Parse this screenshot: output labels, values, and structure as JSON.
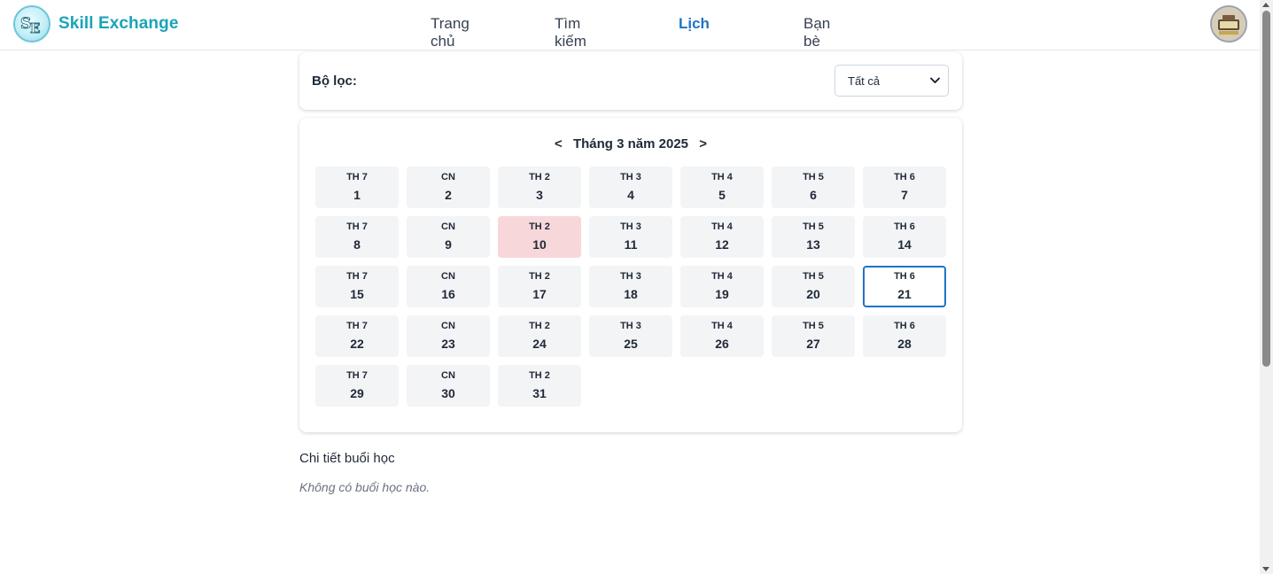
{
  "brand": {
    "name": "Skill Exchange",
    "logo_text": "SE"
  },
  "nav": [
    {
      "label": "Trang chủ",
      "active": false
    },
    {
      "label": "Tìm kiếm",
      "active": false
    },
    {
      "label": "Lịch",
      "active": true
    },
    {
      "label": "Bạn bè",
      "active": false
    }
  ],
  "filter": {
    "label": "Bộ lọc:",
    "selected": "Tất cả"
  },
  "calendar": {
    "prev": "<",
    "next": ">",
    "month_label": "Tháng 3 năm 2025",
    "days": [
      {
        "dow": "TH 7",
        "num": "1"
      },
      {
        "dow": "CN",
        "num": "2"
      },
      {
        "dow": "TH 2",
        "num": "3"
      },
      {
        "dow": "TH 3",
        "num": "4"
      },
      {
        "dow": "TH 4",
        "num": "5"
      },
      {
        "dow": "TH 5",
        "num": "6"
      },
      {
        "dow": "TH 6",
        "num": "7"
      },
      {
        "dow": "TH 7",
        "num": "8"
      },
      {
        "dow": "CN",
        "num": "9"
      },
      {
        "dow": "TH 2",
        "num": "10",
        "state": "today"
      },
      {
        "dow": "TH 3",
        "num": "11"
      },
      {
        "dow": "TH 4",
        "num": "12"
      },
      {
        "dow": "TH 5",
        "num": "13"
      },
      {
        "dow": "TH 6",
        "num": "14"
      },
      {
        "dow": "TH 7",
        "num": "15"
      },
      {
        "dow": "CN",
        "num": "16"
      },
      {
        "dow": "TH 2",
        "num": "17"
      },
      {
        "dow": "TH 3",
        "num": "18"
      },
      {
        "dow": "TH 4",
        "num": "19"
      },
      {
        "dow": "TH 5",
        "num": "20"
      },
      {
        "dow": "TH 6",
        "num": "21",
        "state": "selected"
      },
      {
        "dow": "TH 7",
        "num": "22"
      },
      {
        "dow": "CN",
        "num": "23"
      },
      {
        "dow": "TH 2",
        "num": "24"
      },
      {
        "dow": "TH 3",
        "num": "25"
      },
      {
        "dow": "TH 4",
        "num": "26"
      },
      {
        "dow": "TH 5",
        "num": "27"
      },
      {
        "dow": "TH 6",
        "num": "28"
      },
      {
        "dow": "TH 7",
        "num": "29"
      },
      {
        "dow": "CN",
        "num": "30"
      },
      {
        "dow": "TH 2",
        "num": "31"
      }
    ]
  },
  "details": {
    "title": "Chi tiết buổi học",
    "empty": "Không có buổi học nào."
  },
  "colors": {
    "brand": "#1aa4b8",
    "active_nav": "#1d74c4",
    "today_bg": "#f8d7da",
    "selected_border": "#1d74c4"
  }
}
